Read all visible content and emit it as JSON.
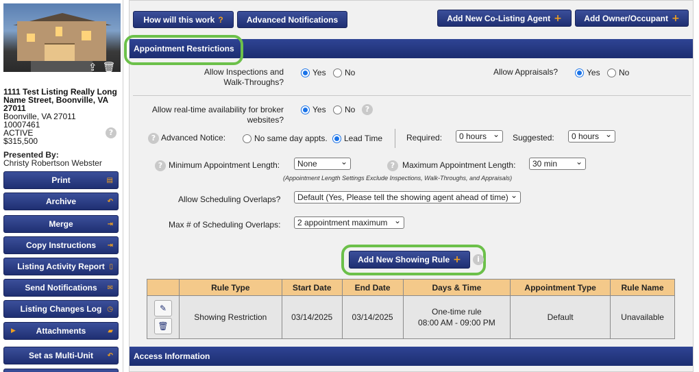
{
  "listing": {
    "address_line1": "1111 Test Listing Really Long",
    "address_line2": "Name Street, Boonville, VA",
    "address_line3": "27011",
    "city_state_zip": "Boonville, VA 27011",
    "mls_number": "10007461",
    "status": "ACTIVE",
    "price": "$315,500",
    "presented_by_label": "Presented By:",
    "presented_by_name": "Christy Robertson Webster"
  },
  "photo_icons": {
    "upload": "upload-icon",
    "delete": "trash-icon"
  },
  "sidebar": {
    "items": [
      {
        "label": "Print",
        "icon": "print-icon"
      },
      {
        "label": "Archive",
        "icon": "undo-icon"
      },
      {
        "label": "Merge",
        "icon": "arrow-in-icon"
      },
      {
        "label": "Copy Instructions",
        "icon": "arrow-in-icon"
      },
      {
        "label": "Listing Activity Report",
        "icon": "document-icon"
      },
      {
        "label": "Send Notifications",
        "icon": "envelope-icon"
      },
      {
        "label": "Listing Changes Log",
        "icon": "clock-icon"
      },
      {
        "label": "Attachments",
        "icon": "folder-icon"
      },
      {
        "label": "Set as Multi-Unit",
        "icon": "undo-icon"
      }
    ]
  },
  "toolbar": {
    "how_label": "How will this work",
    "how_suffix": "?",
    "advanced_notifications": "Advanced Notifications",
    "add_colisting": "Add New Co-Listing Agent",
    "add_owner": "Add Owner/Occupant",
    "plus": "+"
  },
  "appointment_restrictions": {
    "title": "Appointment Restrictions",
    "inspections_label_1": "Allow Inspections and",
    "inspections_label_2": "Walk-Throughs?",
    "inspections_value": "Yes",
    "appraisals_label": "Allow Appraisals?",
    "appraisals_value": "Yes",
    "yes": "Yes",
    "no": "No",
    "realtime_label_1": "Allow real-time availability for broker",
    "realtime_label_2": "websites?",
    "realtime_value": "Yes",
    "advanced_notice_label": "Advanced Notice:",
    "no_same_day": "No same day appts.",
    "lead_time": "Lead Time",
    "advanced_notice_value": "Lead Time",
    "required_label": "Required:",
    "required_value": "0 hours",
    "suggested_label": "Suggested:",
    "suggested_value": "0 hours",
    "min_length_label": "Minimum Appointment Length:",
    "min_length_value": "None",
    "max_length_label": "Maximum Appointment Length:",
    "max_length_value": "30 min",
    "length_note": "(Appointment Length Settings Exclude Inspections, Walk-Throughs, and Appraisals)",
    "overlaps_label": "Allow Scheduling Overlaps?",
    "overlaps_value": "Default (Yes, Please tell the showing agent ahead of time)",
    "max_overlaps_label": "Max # of Scheduling Overlaps:",
    "max_overlaps_value": "2 appointment maximum",
    "add_rule_label": "Add New Showing Rule",
    "help": "?",
    "info": "i"
  },
  "rules_table": {
    "columns": [
      "",
      "Rule Type",
      "Start Date",
      "End Date",
      "Days & Time",
      "Appointment Type",
      "Rule Name"
    ],
    "rows": [
      {
        "rule_type": "Showing Restriction",
        "start_date": "03/14/2025",
        "end_date": "03/14/2025",
        "days_line1": "One-time rule",
        "days_line2": "08:00 AM - 09:00 PM",
        "appointment_type": "Default",
        "rule_name": "Unavailable"
      }
    ]
  },
  "access_information": {
    "title": "Access Information"
  },
  "colors": {
    "navy": "#1f2f72",
    "accent_orange": "#f0a020",
    "highlight_green": "#6cc04a",
    "table_header": "#f4c98a"
  }
}
